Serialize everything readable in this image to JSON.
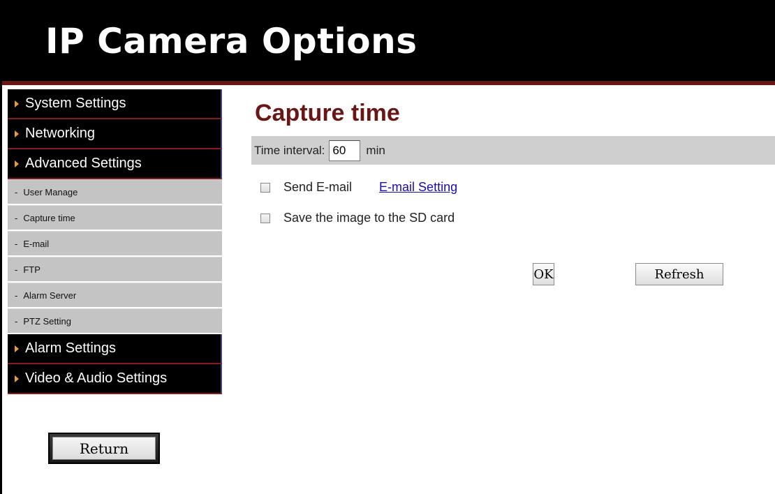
{
  "header": {
    "title": "IP Camera Options"
  },
  "sidebar": {
    "items": [
      {
        "label": "System Settings",
        "type": "main"
      },
      {
        "label": "Networking",
        "type": "main"
      },
      {
        "label": "Advanced Settings",
        "type": "main"
      },
      {
        "label": "User Manage",
        "type": "sub"
      },
      {
        "label": "Capture time",
        "type": "sub"
      },
      {
        "label": "E-mail",
        "type": "sub"
      },
      {
        "label": "FTP",
        "type": "sub"
      },
      {
        "label": "Alarm Server",
        "type": "sub"
      },
      {
        "label": "PTZ Setting",
        "type": "sub"
      },
      {
        "label": "Alarm Settings",
        "type": "main"
      },
      {
        "label": "Video & Audio Settings",
        "type": "main"
      }
    ],
    "dash": "-",
    "return_label": "Return"
  },
  "main": {
    "title": "Capture time",
    "interval": {
      "label": "Time interval:",
      "value": "60",
      "unit": "min"
    },
    "send_email": {
      "label": "Send E-mail",
      "checked": false,
      "link": "E-mail Setting"
    },
    "save_sd": {
      "label": "Save the image to the SD card",
      "checked": false
    },
    "ok_label": "OK",
    "refresh_label": "Refresh"
  },
  "colors": {
    "header_bg": "#000000",
    "accent": "#6b1515",
    "arrow": "#e8a030",
    "submenu_bg": "#c4c4c4",
    "link": "#1a0db0"
  }
}
